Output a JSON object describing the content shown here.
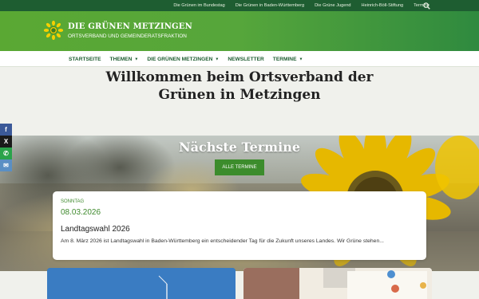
{
  "topbar": {
    "links": [
      "Die Grünen im Bundestag",
      "Die Grünen in Baden-Württemberg",
      "Die Grüne Jugend",
      "Heinrich-Böll-Stiftung",
      "Termine"
    ],
    "search_icon": "search-icon"
  },
  "header": {
    "title": "DIE GRÜNEN METZINGEN",
    "subtitle": "ORTSVERBAND UND GEMEINDERATSFRAKTION",
    "logo_icon": "sunflower-icon"
  },
  "nav": {
    "items": [
      {
        "label": "STARTSEITE",
        "dropdown": false
      },
      {
        "label": "THEMEN",
        "dropdown": true
      },
      {
        "label": "DIE GRÜNEN METZINGEN",
        "dropdown": true
      },
      {
        "label": "NEWSLETTER",
        "dropdown": false
      },
      {
        "label": "TERMINE",
        "dropdown": true
      }
    ]
  },
  "welcome": {
    "line1": "Willkommen beim Ortsverband der",
    "line2": "Grünen in Metzingen"
  },
  "hero": {
    "title": "Nächste Termine",
    "button_label": "ALLE TERMINE"
  },
  "event": {
    "day": "SONNTAG",
    "date": "08.03.2026",
    "title": "Landtagswahl 2026",
    "text": "Am 8. März 2026 ist Landtagswahl in Baden-Württemberg ein entscheidender Tag für die Zukunft unseres Landes. Wir Grüne stehen..."
  },
  "share": [
    {
      "icon": "facebook-icon",
      "glyph": "f",
      "color": "#3b5998"
    },
    {
      "icon": "x-icon",
      "glyph": "X",
      "color": "#1a1a1a"
    },
    {
      "icon": "whatsapp-icon",
      "glyph": "✆",
      "color": "#2aa34a"
    },
    {
      "icon": "email-icon",
      "glyph": "✉",
      "color": "#5a8fc4"
    }
  ],
  "colors": {
    "dark_green": "#1e5d31",
    "brand_green": "#5aa833",
    "button_green": "#3c8c2c",
    "sunflower_yellow": "#f5d000"
  }
}
